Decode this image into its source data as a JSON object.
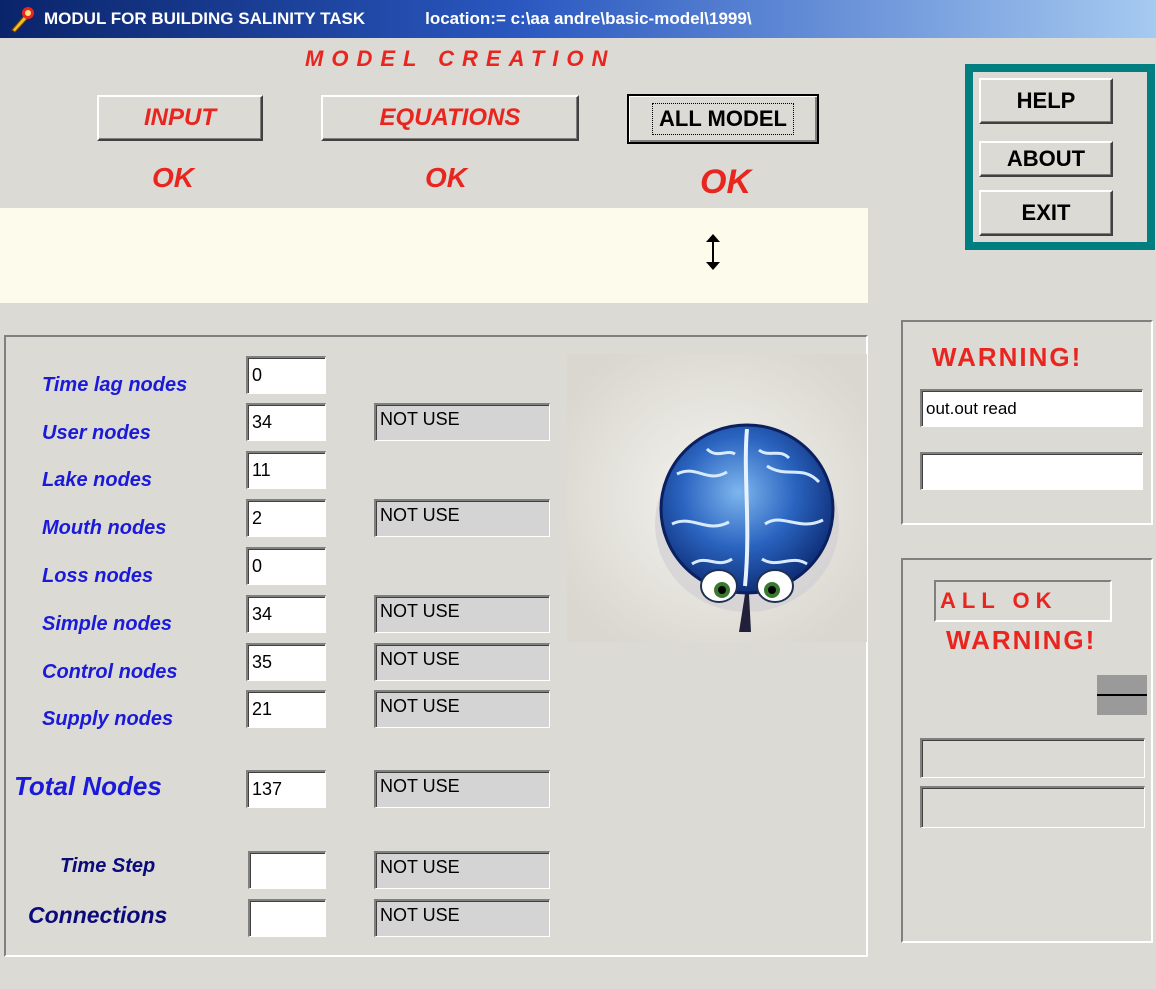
{
  "window": {
    "title": "MODUL FOR BUILDING SALINITY TASK",
    "location": "location:= c:\\aa andre\\basic-model\\1999\\"
  },
  "header": {
    "model_creation": "MODEL CREATION",
    "input_button": "INPUT",
    "equations_button": "EQUATIONS",
    "all_model_button": "ALL MODEL",
    "input_status": "OK",
    "equations_status": "OK",
    "all_model_status": "OK"
  },
  "right_menu": {
    "help_button": "HELP",
    "about_button": "ABOUT",
    "exit_button": "EXIT"
  },
  "nodes": [
    {
      "label": "Time lag nodes",
      "value": "0",
      "status": ""
    },
    {
      "label": "User nodes",
      "value": "34",
      "status": "NOT USE"
    },
    {
      "label": "Lake nodes",
      "value": "11",
      "status": ""
    },
    {
      "label": "Mouth nodes",
      "value": "2",
      "status": "NOT USE"
    },
    {
      "label": "Loss nodes",
      "value": "0",
      "status": ""
    },
    {
      "label": "Simple nodes",
      "value": "34",
      "status": "NOT USE"
    },
    {
      "label": "Control nodes",
      "value": "35",
      "status": "NOT USE"
    },
    {
      "label": "Supply nodes",
      "value": "21",
      "status": "NOT USE"
    }
  ],
  "totals": {
    "total_label": "Total Nodes",
    "total_value": "137",
    "total_status": "NOT USE",
    "time_step_label": "Time Step",
    "time_step_value": "",
    "time_step_status": "NOT USE",
    "connections_label": "Connections",
    "connections_value": "",
    "connections_status": "NOT USE"
  },
  "warning_panel": {
    "title": "WARNING!",
    "message1": "out.out read",
    "message2": ""
  },
  "status_panel": {
    "all_ok": "ALL  OK",
    "warning": "WARNING!",
    "field1": "",
    "field2": ""
  },
  "colors": {
    "accent_red": "#e8261f",
    "label_blue": "#1a1ad8",
    "teal_frame": "#007e80",
    "titlebar": "#0a246a"
  }
}
